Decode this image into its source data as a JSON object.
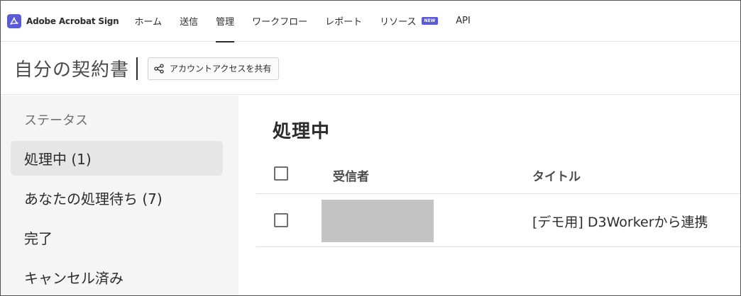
{
  "brand": {
    "name": "Adobe Acrobat Sign"
  },
  "nav": {
    "items": [
      {
        "label": "ホーム"
      },
      {
        "label": "送信"
      },
      {
        "label": "管理",
        "active": true
      },
      {
        "label": "ワークフロー"
      },
      {
        "label": "レポート"
      },
      {
        "label": "リソース",
        "badge": "NEW"
      },
      {
        "label": "API"
      }
    ]
  },
  "header": {
    "title": "自分の契約書",
    "share_label": "アカウントアクセスを共有"
  },
  "sidebar": {
    "heading": "ステータス",
    "items": [
      {
        "label": "処理中 (1)",
        "selected": true
      },
      {
        "label": "あなたの処理待ち (7)"
      },
      {
        "label": "完了"
      },
      {
        "label": "キャンセル済み"
      }
    ]
  },
  "main": {
    "title": "処理中",
    "columns": {
      "recipient": "受信者",
      "title": "タイトル"
    },
    "rows": [
      {
        "title": "[デモ用] D3Workerから連携"
      }
    ]
  },
  "colors": {
    "accent": "#5b5bd6",
    "selected_bg": "#e6e6e6",
    "sidebar_bg": "#f5f5f5"
  }
}
